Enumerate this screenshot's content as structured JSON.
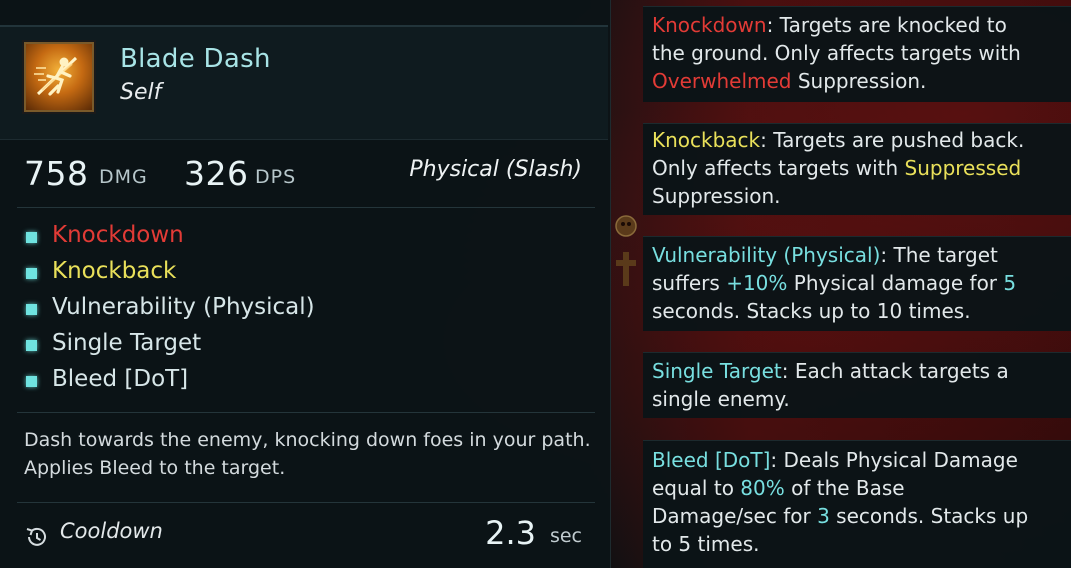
{
  "ability": {
    "name": "Blade Dash",
    "target": "Self",
    "icon": "blade-dash-runner-icon"
  },
  "stats": {
    "damage_value": "758",
    "damage_unit": "DMG",
    "dps_value": "326",
    "dps_unit": "DPS",
    "damage_type": "Physical (Slash)"
  },
  "tags": [
    {
      "label": "Knockdown",
      "color": "#e23b36"
    },
    {
      "label": "Knockback",
      "color": "#e9e05a"
    },
    {
      "label": "Vulnerability (Physical)",
      "color": "#d7e6e8"
    },
    {
      "label": "Single Target",
      "color": "#d7e6e8"
    },
    {
      "label": "Bleed [DoT]",
      "color": "#d7e6e8"
    }
  ],
  "description": "Dash towards the enemy, knocking down foes in your path. Applies Bleed to the target.",
  "cooldown": {
    "label": "Cooldown",
    "value": "2.3",
    "unit": "sec"
  },
  "keywords": {
    "knockdown": {
      "l1_kw": "Knockdown",
      "l1_rest": ": Targets are knocked to",
      "l2": "the ground. Only affects targets with",
      "l3_kw": "Overwhelmed",
      "l3_rest": " Suppression."
    },
    "knockback": {
      "l1_kw": "Knockback",
      "l1_rest": ": Targets are pushed back.",
      "l2_pre": "Only affects targets with ",
      "l2_kw": "Suppressed",
      "l3": "Suppression."
    },
    "vulnerability": {
      "l1_kw": "Vulnerability (Physical)",
      "l1_rest": ": The target",
      "l2_pre": "suffers ",
      "l2_val": "+10%",
      "l2_mid": " Physical damage for ",
      "l2_num": "5",
      "l3": "seconds. Stacks up to 10 times."
    },
    "single_target": {
      "l1_kw": "Single Target",
      "l1_rest": ": Each attack targets a",
      "l2": "single enemy."
    },
    "bleed": {
      "l1_kw": "Bleed [DoT]",
      "l1_rest": ": Deals Physical Damage",
      "l2_pre": "equal to ",
      "l2_val": "80%",
      "l2_rest": " of the Base",
      "l3_pre": "Damage/sec for ",
      "l3_num": "3",
      "l3_rest": " seconds. Stacks up",
      "l4": "to 5 times."
    }
  },
  "colors": {
    "accent_cyan": "#78dfe0",
    "title_cyan": "#a8e4e6",
    "keyword_red": "#e23b36",
    "keyword_yellow": "#e9e05a"
  }
}
